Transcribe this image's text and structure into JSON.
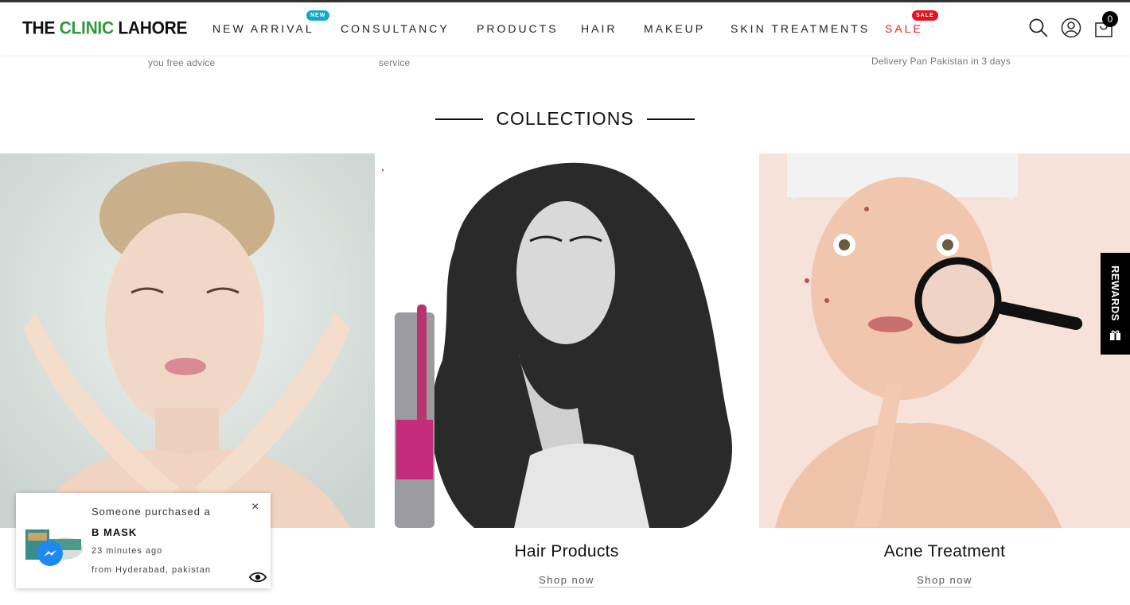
{
  "header": {
    "logo_part1": "THE ",
    "logo_part2": "CLINIC",
    "logo_part3": " LAHORE",
    "nav": [
      {
        "label": "NEW ARRIVAL",
        "badge": "NEW"
      },
      {
        "label": "CONSULTANCY"
      },
      {
        "label": "PRODUCTS"
      },
      {
        "label": "HAIR"
      },
      {
        "label": "MAKEUP"
      },
      {
        "label": "SKIN TREATMENTS"
      },
      {
        "label": "SALE",
        "badge": "SALE"
      }
    ],
    "icons": [
      "search-icon",
      "account-icon",
      "cart-icon"
    ],
    "cart_count": "0"
  },
  "features": {
    "f1": "you free advice",
    "f2": "service",
    "f3": "Delivery Pan Pakistan in 3 days"
  },
  "collections": {
    "title": "COLLECTIONS",
    "items": [
      {
        "name": "",
        "link": ""
      },
      {
        "name": "Hair Products",
        "link": "Shop now"
      },
      {
        "name": "Acne Treatment",
        "link": "Shop now"
      }
    ]
  },
  "rewards": {
    "label": "REWARDS"
  },
  "popup": {
    "line1": "Someone purchased a",
    "product": "B MASK",
    "time": "23 minutes ago",
    "location": "from Hyderabad, pakistan",
    "close": "×"
  },
  "colors": {
    "logo_green": "#2e9a3c",
    "sale_red": "#e32129",
    "new_badge": "#12a9c8",
    "rewards_bg": "#000000",
    "messenger_blue": "#1e88f5"
  }
}
